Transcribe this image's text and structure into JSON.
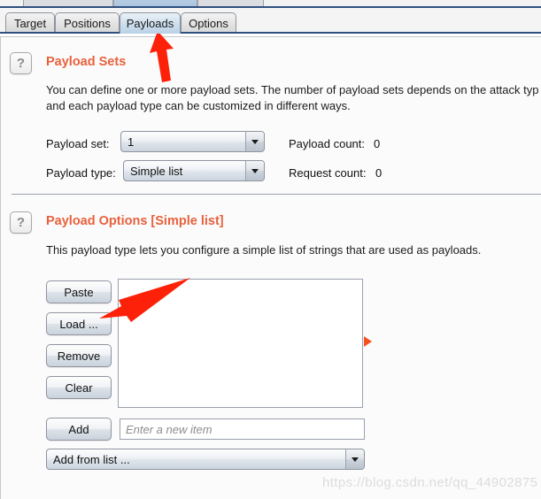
{
  "window": {
    "upper_tabs_partial": [
      "",
      "",
      ""
    ]
  },
  "tabs": [
    {
      "label": "Target",
      "selected": false
    },
    {
      "label": "Positions",
      "selected": false
    },
    {
      "label": "Payloads",
      "selected": true
    },
    {
      "label": "Options",
      "selected": false
    }
  ],
  "sections": {
    "payload_sets": {
      "help_glyph": "?",
      "title": "Payload Sets",
      "description_line1": "You can define one or more payload sets. The number of payload sets depends on the attack typ",
      "description_line2": "and each payload type can be customized in different ways.",
      "payload_set_label": "Payload set:",
      "payload_set_value": "1",
      "payload_type_label": "Payload type:",
      "payload_type_value": "Simple list",
      "payload_count_label": "Payload count:",
      "payload_count_value": "0",
      "request_count_label": "Request count:",
      "request_count_value": "0"
    },
    "payload_options": {
      "help_glyph": "?",
      "title": "Payload Options [Simple list]",
      "description": "This payload type lets you configure a simple list of strings that are used as payloads.",
      "buttons": {
        "paste": "Paste",
        "load": "Load ...",
        "remove": "Remove",
        "clear": "Clear",
        "add": "Add"
      },
      "new_item_placeholder": "Enter a new item",
      "new_item_value": "",
      "add_from_list_value": "Add from list ...",
      "list_items": []
    }
  },
  "annotations": {
    "arrow_color": "#fd2109",
    "splitter_color": "#f4511e",
    "arrow_to_payloads_tab": "arrow pointing to Payloads tab",
    "arrow_to_load_button": "arrow pointing to Load ... button"
  },
  "watermark": {
    "text": "https://blog.csdn.net/qq_44902875"
  }
}
